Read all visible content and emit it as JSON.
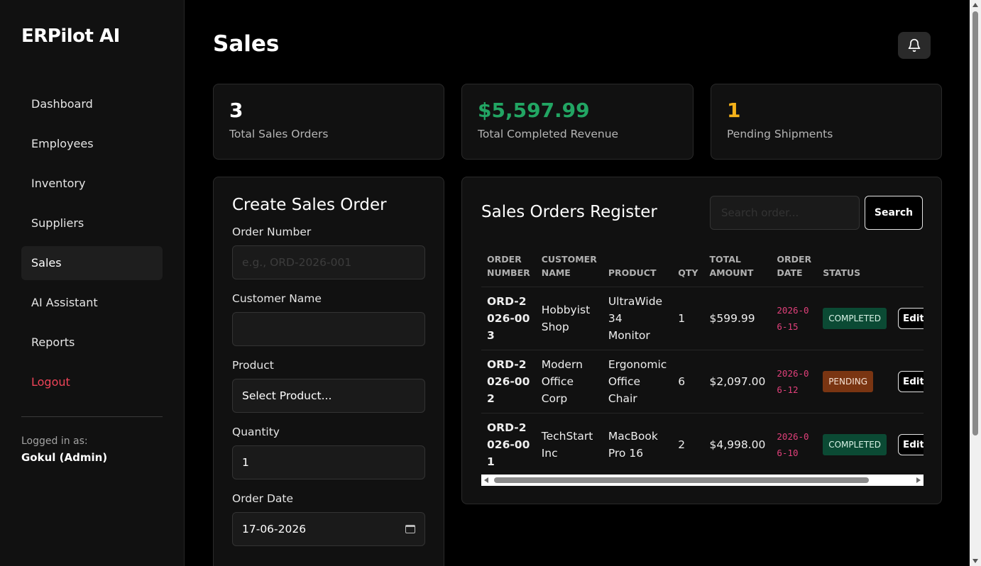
{
  "app": {
    "brand": "ERPilot AI"
  },
  "sidebar": {
    "items": [
      {
        "label": "Dashboard"
      },
      {
        "label": "Employees"
      },
      {
        "label": "Inventory"
      },
      {
        "label": "Suppliers"
      },
      {
        "label": "Sales",
        "active": true
      },
      {
        "label": "AI Assistant"
      },
      {
        "label": "Reports"
      },
      {
        "label": "Logout"
      }
    ],
    "logged_in_label": "Logged in as:",
    "logged_in_user": "Gokul (Admin)"
  },
  "header": {
    "title": "Sales",
    "notification_icon": "bell-icon"
  },
  "stats": [
    {
      "value": "3",
      "label": "Total Sales Orders",
      "color": "#ffffff"
    },
    {
      "value": "$5,597.99",
      "label": "Total Completed Revenue",
      "color": "#22a563"
    },
    {
      "value": "1",
      "label": "Pending Shipments",
      "color": "#f5b21a"
    }
  ],
  "form": {
    "title": "Create Sales Order",
    "order_number": {
      "label": "Order Number",
      "placeholder": "e.g., ORD-2026-001",
      "value": ""
    },
    "customer_name": {
      "label": "Customer Name",
      "value": ""
    },
    "product": {
      "label": "Product",
      "value": "Select Product..."
    },
    "quantity": {
      "label": "Quantity",
      "value": "1"
    },
    "order_date": {
      "label": "Order Date",
      "value": "17-06-2026"
    }
  },
  "register": {
    "title": "Sales Orders Register",
    "search_placeholder": "Search order...",
    "search_label": "Search",
    "columns": [
      "ORDER NUMBER",
      "CUSTOMER NAME",
      "PRODUCT",
      "QTY",
      "TOTAL AMOUNT",
      "ORDER DATE",
      "STATUS"
    ],
    "edit_label": "Edit",
    "rows": [
      {
        "order_number": "ORD-2026-003",
        "customer": "Hobbyist Shop",
        "product": "UltraWide 34 Monitor",
        "qty": "1",
        "amount": "$599.99",
        "date": "2026-06-15",
        "status": "COMPLETED"
      },
      {
        "order_number": "ORD-2026-002",
        "customer": "Modern Office Corp",
        "product": "Ergonomic Office Chair",
        "qty": "6",
        "amount": "$2,097.00",
        "date": "2026-06-12",
        "status": "PENDING"
      },
      {
        "order_number": "ORD-2026-001",
        "customer": "TechStart Inc",
        "product": "MacBook Pro 16",
        "qty": "2",
        "amount": "$4,998.00",
        "date": "2026-06-10",
        "status": "COMPLETED"
      }
    ]
  }
}
